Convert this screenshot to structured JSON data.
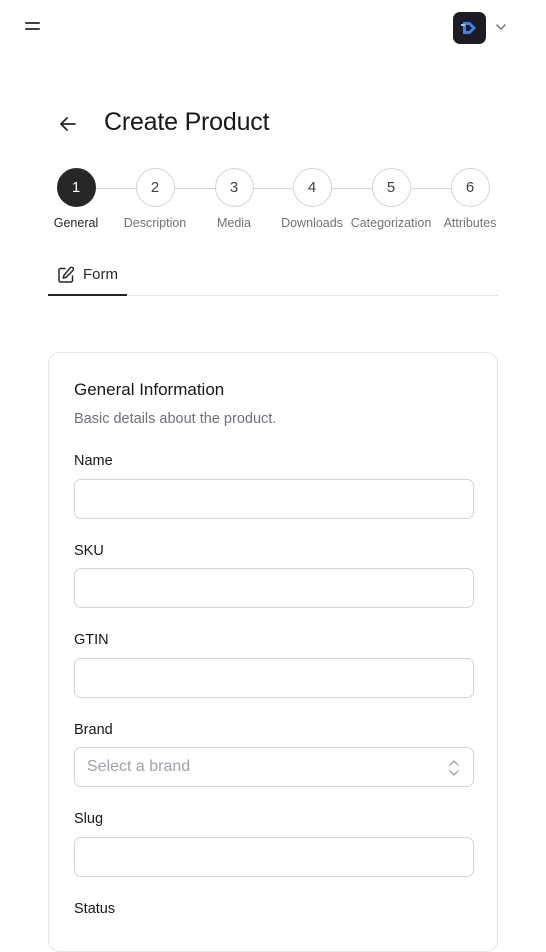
{
  "topbar": {
    "menu_icon": "hamburger-menu-icon",
    "logo_icon": "app-logo-icon",
    "chevron_icon": "chevron-down-icon"
  },
  "header": {
    "back_icon": "arrow-left-icon",
    "title": "Create Product"
  },
  "stepper": {
    "steps": [
      {
        "number": "1",
        "label": "General",
        "active": true
      },
      {
        "number": "2",
        "label": "Description",
        "active": false
      },
      {
        "number": "3",
        "label": "Media",
        "active": false
      },
      {
        "number": "4",
        "label": "Downloads",
        "active": false
      },
      {
        "number": "5",
        "label": "Categorization",
        "active": false
      },
      {
        "number": "6",
        "label": "Attributes",
        "active": false
      }
    ]
  },
  "tabs": [
    {
      "label": "Form",
      "icon": "edit-icon",
      "active": true
    }
  ],
  "form": {
    "title": "General Information",
    "description": "Basic details about the product.",
    "fields": {
      "name": {
        "label": "Name",
        "value": ""
      },
      "sku": {
        "label": "SKU",
        "value": ""
      },
      "gtin": {
        "label": "GTIN",
        "value": ""
      },
      "brand": {
        "label": "Brand",
        "placeholder": "Select a brand"
      },
      "slug": {
        "label": "Slug",
        "value": ""
      },
      "status": {
        "label": "Status"
      }
    }
  },
  "colors": {
    "accent": "#27272a",
    "logo_bg": "#1c1c22",
    "logo_blue": "#3b82f6",
    "border": "#d4d4d8",
    "muted_text": "#71717a"
  }
}
